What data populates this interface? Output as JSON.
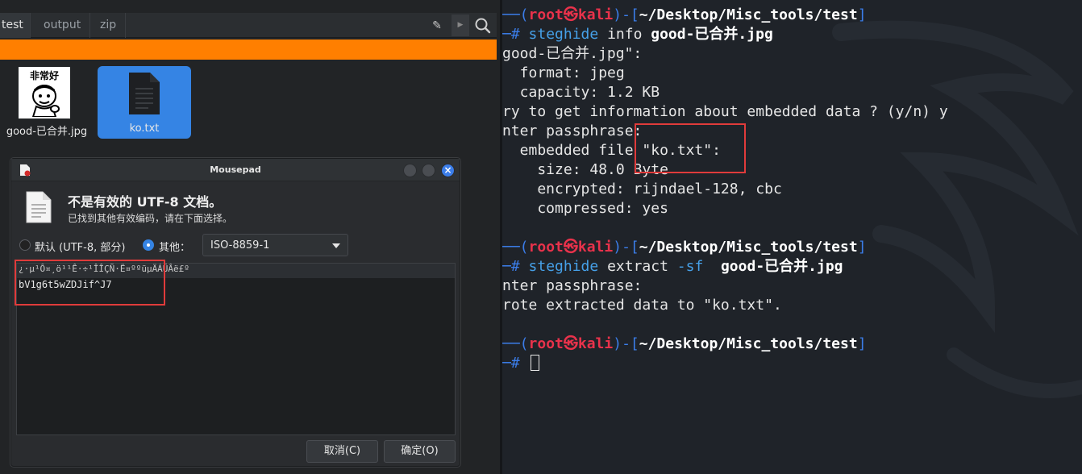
{
  "file_manager": {
    "breadcrumbs": [
      "test",
      "output",
      "zip"
    ],
    "icons": {
      "edit": "pencil-icon",
      "next": "chevron-right-icon",
      "search": "search-icon"
    },
    "accent_color": "#ff7f00",
    "files": [
      {
        "name": "good-已合并.jpg",
        "thumbnail_text": "非常好",
        "icon": "image-thumbnail"
      },
      {
        "name": "ko.txt",
        "icon": "text-document-icon",
        "selected": true
      }
    ]
  },
  "dialog": {
    "title": "Mousepad",
    "heading": "不是有效的 UTF-8 文档。",
    "subtext": "已找到其他有效编码，请在下面选择。",
    "radio_default_label": "默认 (UTF-8, 部分)",
    "radio_other_label": "其他：",
    "selected_radio": "other",
    "encoding_value": "ISO-8859-1",
    "text_line1": "¿·µ¹Ô¤¸ö¹¹Ê·÷¹ÎÎÇÑ·Ë¤ººüµÄÁÜÂë£º",
    "text_line2": "bV1g6t5wZDJif^J7",
    "cancel_label": "取消(C)",
    "ok_label": "确定(O)"
  },
  "terminal": {
    "prompt_user": "root",
    "prompt_host": "kali",
    "prompt_path": "~/Desktop/Misc_tools/test",
    "commands": [
      {
        "cmd": "steghide",
        "args": "info ",
        "file": "good-已合并.jpg"
      },
      {
        "cmd": "steghide",
        "args": "extract ",
        "opt": "-sf",
        "file": "good-已合并.jpg"
      }
    ],
    "output1": [
      "good-已合并.jpg\":",
      "  format: jpeg",
      "  capacity: 1.2 KB",
      "ry to get information about embedded data ? (y/n) y",
      "nter passphrase:",
      "  embedded file \"ko.txt\":",
      "    size: 48.0 Byte",
      "    encrypted: rijndael-128, cbc",
      "    compressed: yes"
    ],
    "output2": [
      "nter passphrase:",
      "rote extracted data to \"ko.txt\"."
    ]
  }
}
